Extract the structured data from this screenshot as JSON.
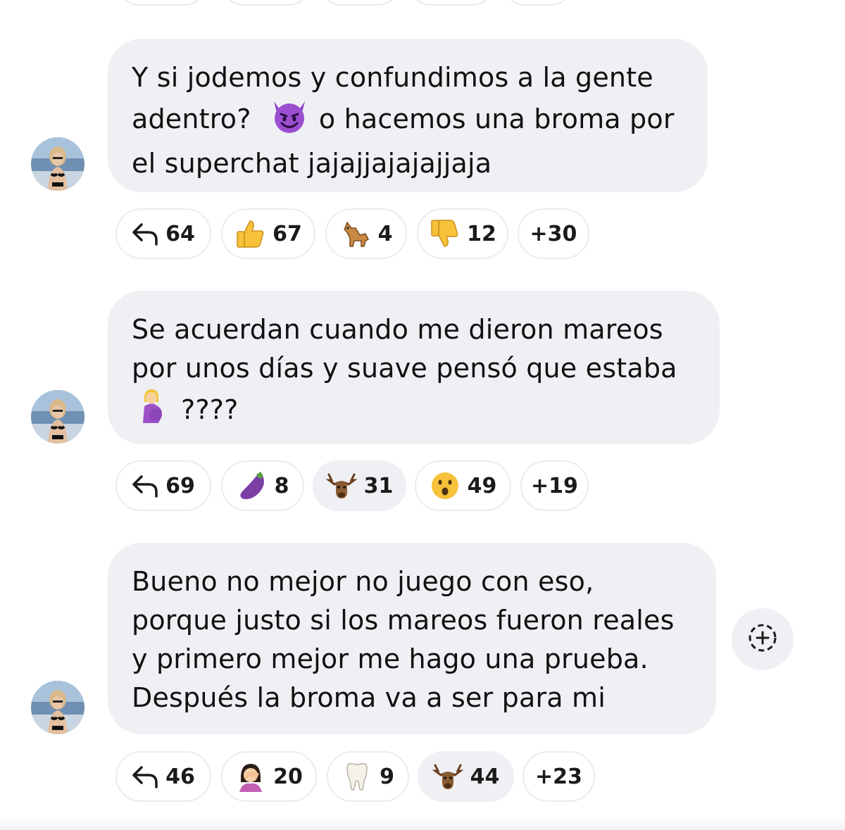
{
  "messages": [
    {
      "lines": [
        "Y si jodemos y confundimos a la gente",
        "adentro?",
        "o hacemos una broma por",
        "el superchat jajajjajajajjaja"
      ],
      "reactions": [
        {
          "icon": "reply-icon",
          "count": "64"
        },
        {
          "icon": "thumbs-up-icon",
          "count": "67"
        },
        {
          "icon": "dog-icon",
          "count": "4"
        },
        {
          "icon": "thumbs-down-icon",
          "count": "12"
        },
        {
          "icon": "",
          "count": "+30"
        }
      ]
    },
    {
      "lines": [
        "Se acuerdan cuando me dieron mareos",
        "por unos días y suave pensó que estaba",
        "????"
      ],
      "reactions": [
        {
          "icon": "reply-icon",
          "count": "69"
        },
        {
          "icon": "eggplant-icon",
          "count": "8"
        },
        {
          "icon": "moose-icon",
          "count": "31",
          "selected": true
        },
        {
          "icon": "surprised-face-icon",
          "count": "49"
        },
        {
          "icon": "",
          "count": "+19"
        }
      ]
    },
    {
      "lines": [
        "Bueno no mejor no juego con eso,",
        "porque justo si los mareos fueron reales",
        "y primero mejor me hago una prueba.",
        "Después la broma va a ser para mi"
      ],
      "reactions": [
        {
          "icon": "reply-icon",
          "count": "46"
        },
        {
          "icon": "facepalm-woman-icon",
          "count": "20"
        },
        {
          "icon": "tooth-icon",
          "count": "9"
        },
        {
          "icon": "moose-icon",
          "count": "44",
          "selected": true
        },
        {
          "icon": "",
          "count": "+23"
        }
      ]
    }
  ],
  "colors": {
    "bubble": "#eff0f3",
    "pill_border": "#ececef",
    "text": "#111111"
  }
}
